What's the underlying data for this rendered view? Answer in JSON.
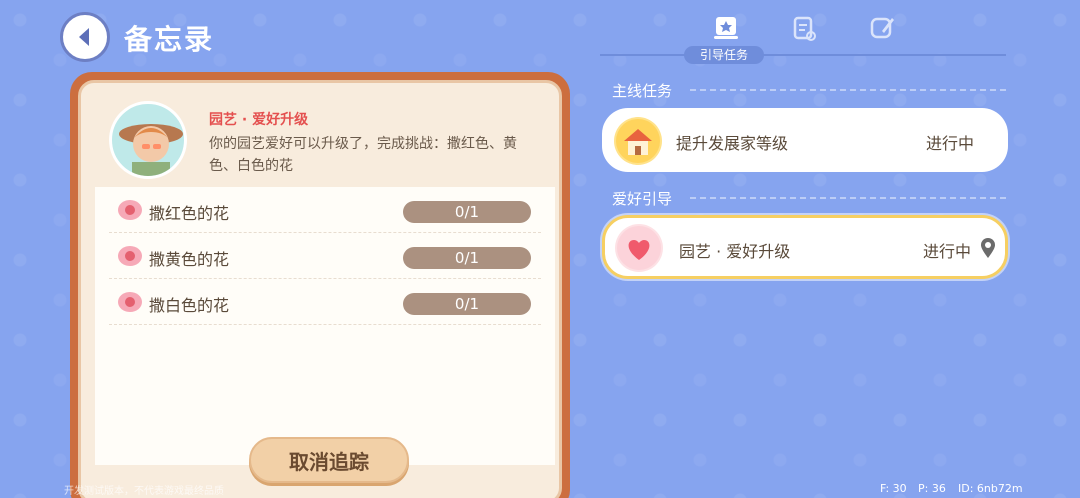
{
  "header": {
    "title": "备忘录"
  },
  "quest": {
    "name": "园艺 · 爱好升级",
    "description": "你的园艺爱好可以升级了，完成挑战：撒红色、黄色、白色的花",
    "tasks": [
      {
        "label": "撒红色的花",
        "progress": "0/1"
      },
      {
        "label": "撒黄色的花",
        "progress": "0/1"
      },
      {
        "label": "撒白色的花",
        "progress": "0/1"
      }
    ],
    "cancel_label": "取消追踪"
  },
  "tabs": {
    "active_label": "引导任务"
  },
  "main_quest": {
    "section_title": "主线任务",
    "name": "提升发展家等级",
    "status": "进行中"
  },
  "hobby_guide": {
    "section_title": "爱好引导",
    "name": "园艺 · 爱好升级",
    "status": "进行中"
  },
  "footer": {
    "disclaimer": "开发测试版本，不代表游戏最终品质",
    "fps": "F: 30",
    "ping": "P: 36",
    "id": "ID: 6nb72m"
  },
  "colors": {
    "background": "#86a4ef",
    "panel_border": "#cc6e3f",
    "quest_name": "#e4504f",
    "progress_bar": "#ab9180",
    "active_card_border": "#f6cf62"
  },
  "icons": {
    "back": "chevron-left-icon",
    "task": "flower-icon",
    "tab1": "guide-icon",
    "tab2": "clipboard-icon",
    "tab3": "edit-icon",
    "main_quest": "house-icon",
    "hobby": "heart-icon",
    "locate": "location-pin-icon"
  }
}
